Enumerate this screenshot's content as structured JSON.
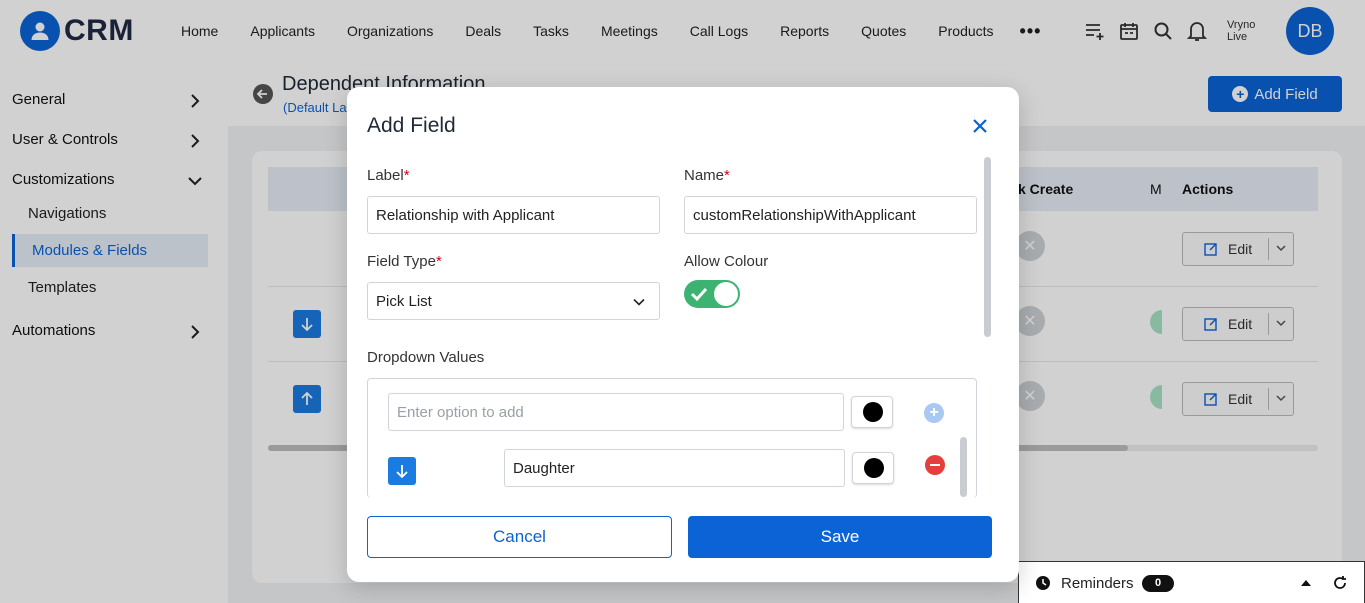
{
  "brand": {
    "logo_text": "CRM",
    "accent": "#0b63d6"
  },
  "nav": {
    "items": [
      "Home",
      "Applicants",
      "Organizations",
      "Deals",
      "Tasks",
      "Meetings",
      "Call Logs",
      "Reports",
      "Quotes",
      "Products"
    ],
    "more": "•••"
  },
  "user": {
    "name_line1": "Vryno",
    "name_line2": "Live",
    "initials": "DB"
  },
  "sidebar": {
    "general": "General",
    "user_controls": "User & Controls",
    "customizations": "Customizations",
    "navigations": "Navigations",
    "modules_fields": "Modules & Fields",
    "templates": "Templates",
    "automations": "Automations"
  },
  "page": {
    "title": "Dependent Information",
    "subtitle": "(Default La",
    "add_field_label": "Add Field"
  },
  "table": {
    "headers": {
      "quick_create": "k Create",
      "m": "M",
      "actions": "Actions"
    },
    "edit_label": "Edit"
  },
  "reminders": {
    "label": "Reminders",
    "count": "0"
  },
  "modal": {
    "title": "Add Field",
    "label_label": "Label",
    "label_value": "Relationship with Applicant",
    "name_label": "Name",
    "name_value": "customRelationshipWithApplicant",
    "field_type_label": "Field Type",
    "field_type_value": "Pick List",
    "allow_colour_label": "Allow Colour",
    "allow_colour_on": true,
    "dropdown_values_label": "Dropdown Values",
    "option_placeholder": "Enter option to add",
    "options": [
      "Daughter"
    ],
    "cancel_label": "Cancel",
    "save_label": "Save",
    "required_mark": "*"
  }
}
